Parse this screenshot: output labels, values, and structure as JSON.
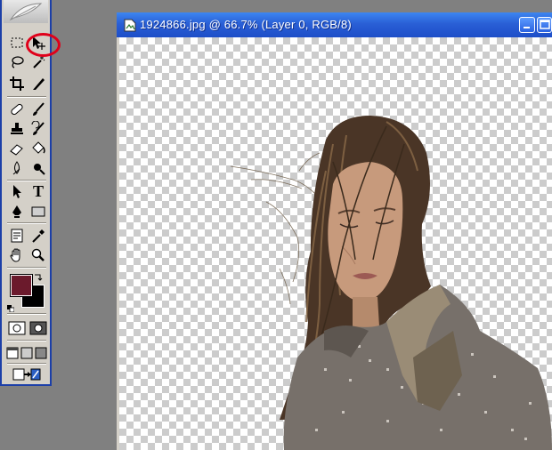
{
  "document": {
    "title": "1924866.jpg @ 66.7% (Layer 0, RGB/8)",
    "minimize_icon": "minimize-icon",
    "maximize_icon": "maximize-icon"
  },
  "colors": {
    "foreground": "#6b1a2c",
    "background": "#000000",
    "annotation_circle": "#e0001a",
    "titlebar": "#2a5fd6"
  },
  "tools": {
    "type_label": "T",
    "items": [
      "feather-logo-icon",
      "rectangular-marquee-icon",
      "move-tool-icon",
      "lasso-icon",
      "magic-wand-icon",
      "crop-icon",
      "slice-icon",
      "healing-brush-icon",
      "brush-icon",
      "clone-stamp-icon",
      "history-brush-icon",
      "eraser-icon",
      "paint-bucket-icon",
      "blur-icon",
      "dodge-icon",
      "path-selection-icon",
      "type-tool-icon",
      "pen-icon",
      "rectangle-shape-icon",
      "notes-icon",
      "eyedropper-icon",
      "hand-icon",
      "zoom-icon",
      "standard-mode-icon",
      "quick-mask-icon",
      "standard-screen-icon",
      "full-screen-menu-icon",
      "full-screen-icon",
      "jump-to-imageready-icon"
    ]
  }
}
